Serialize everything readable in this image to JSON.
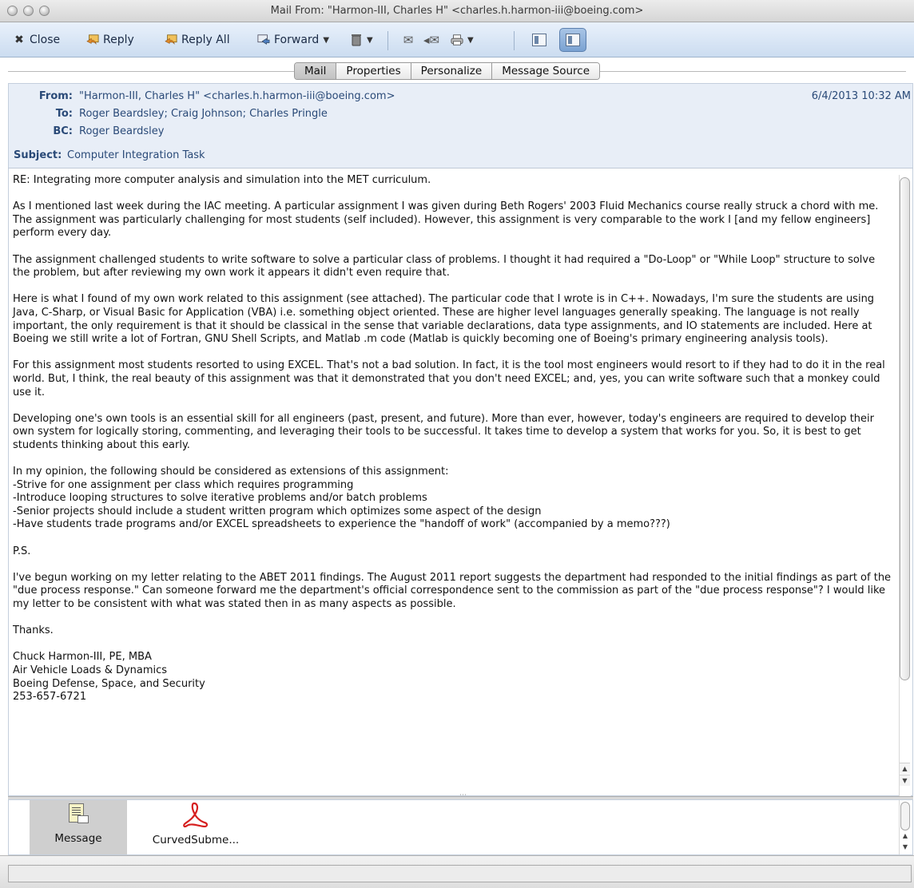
{
  "window": {
    "title": "Mail From: \"Harmon-III, Charles H\" <charles.h.harmon-iii@boeing.com>"
  },
  "toolbar": {
    "close_label": "Close",
    "reply_label": "Reply",
    "reply_all_label": "Reply All",
    "forward_label": "Forward"
  },
  "tabs": [
    "Mail",
    "Properties",
    "Personalize",
    "Message Source"
  ],
  "header": {
    "from_label": "From:",
    "from_value": "\"Harmon-III, Charles H\" <charles.h.harmon-iii@boeing.com>",
    "date": "6/4/2013 10:32 AM",
    "to_label": "To:",
    "to_value": "Roger Beardsley; Craig Johnson; Charles Pringle",
    "bc_label": "BC:",
    "bc_value": "Roger Beardsley",
    "subject_label": "Subject:",
    "subject_value": "Computer Integration Task"
  },
  "body": {
    "p1": "RE: Integrating more computer analysis and simulation into the MET curriculum.",
    "p2": "As I mentioned last week during the IAC meeting.  A particular assignment I was given during Beth Rogers' 2003 Fluid Mechanics course really struck a chord with me.  The assignment was particularly challenging for most students (self included).  However, this assignment is very comparable to the work I [and my fellow engineers] perform every day.",
    "p3": "The assignment challenged students to write software to solve a particular class of problems.  I thought it had required a \"Do-Loop\" or \"While Loop\" structure to solve the problem, but after reviewing my own work it appears it didn't even require that.",
    "p4": "Here is what I found of my own work related to this assignment (see attached).  The particular code that I wrote is in C++.  Nowadays, I'm sure the students are using Java, C-Sharp, or Visual Basic for Application (VBA) i.e. something object oriented.  These are higher level languages generally speaking.  The language is not really important, the only requirement is that it should be classical in the sense that variable declarations, data type assignments, and IO statements are included.  Here at Boeing we still write a lot of Fortran, GNU Shell Scripts, and Matlab .m code (Matlab is quickly becoming one of Boeing's primary engineering analysis tools).",
    "p5": "For this assignment most students resorted to using EXCEL.  That's not a bad solution.  In fact, it is the tool most engineers would resort to if they had to do it in the real world.  But, I think, the real beauty of this assignment was that it demonstrated that you don't need EXCEL; and, yes, you can write software such that a monkey could use it.",
    "p6": "Developing one's own tools is an essential skill for all engineers (past, present, and future).  More than ever, however, today's engineers are required to develop their own system for logically storing, commenting, and leveraging their tools to be successful.  It takes time to develop a system that works for you.  So, it is best to get students thinking about this early.",
    "p7_intro": "In my opinion, the following should be considered as extensions of this assignment:",
    "p7_item1": "-Strive for one assignment per class which requires programming",
    "p7_item2": "-Introduce looping structures to solve iterative problems and/or batch problems",
    "p7_item3": "-Senior projects should include a student written program which optimizes some aspect of the design",
    "p7_item4": "-Have students trade programs and/or EXCEL spreadsheets to experience the \"handoff of work\" (accompanied by a memo???)",
    "p8": "P.S.",
    "p9": "I've begun working on my letter relating to the ABET 2011 findings.  The August 2011 report suggests the department had responded to the initial findings as part of the \"due process response.\"  Can someone forward me the department's official correspondence sent to the commission as part of the \"due process response\"? I would like my letter to be consistent with what was stated then in as many aspects as possible.",
    "p10": "Thanks.",
    "sig1": "Chuck Harmon-III, PE, MBA",
    "sig2": "Air Vehicle Loads & Dynamics",
    "sig3": "Boeing Defense, Space, and Security",
    "sig4": "253-657-6721"
  },
  "attachments": [
    {
      "label": "Message",
      "icon": "message-icon"
    },
    {
      "label": "CurvedSubme...",
      "icon": "pdf-icon"
    }
  ],
  "colors": {
    "header_bg": "#e8eef7",
    "header_text": "#2a4a78",
    "toolbar_bg": "#cbdcf0"
  }
}
